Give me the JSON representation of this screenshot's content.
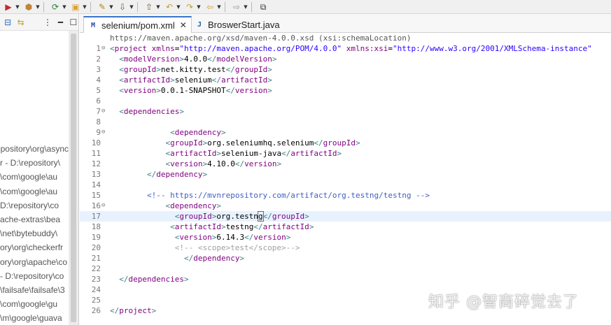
{
  "toolbar": {
    "items": [
      {
        "name": "run-icon",
        "glyph": "▶",
        "color": "#c62828"
      },
      {
        "name": "package-icon",
        "glyph": "⬢",
        "color": "#c0853a"
      },
      {
        "name": "refresh-icon",
        "glyph": "⟳",
        "color": "#2e7d32"
      },
      {
        "name": "open-folder-icon",
        "glyph": "▣",
        "color": "#d9a23a"
      },
      {
        "name": "wand-icon",
        "glyph": "✎",
        "color": "#b8860b"
      },
      {
        "name": "download-icon",
        "glyph": "⇩",
        "color": "#7a5b2e"
      },
      {
        "name": "upload-icon",
        "glyph": "⇧",
        "color": "#7a5b2e"
      },
      {
        "name": "back-history-icon",
        "glyph": "↶",
        "color": "#c7a033"
      },
      {
        "name": "forward-history-icon",
        "glyph": "↷",
        "color": "#c7a033"
      },
      {
        "name": "back-arrow-icon",
        "glyph": "⇦",
        "color": "#c7a033"
      },
      {
        "name": "forward-arrow-icon",
        "glyph": "⇨",
        "color": "#9a9a9a"
      },
      {
        "name": "new-window-icon",
        "glyph": "⧉",
        "color": "#333333"
      }
    ]
  },
  "left_panel": {
    "tools": [
      {
        "name": "collapse-icon",
        "glyph": "⊟",
        "color": "#2f6db5"
      },
      {
        "name": "link-editor-icon",
        "glyph": "⇆",
        "color": "#c7a033"
      },
      {
        "name": "view-menu-icon",
        "glyph": "⋮",
        "color": "#333333"
      },
      {
        "name": "minimize-icon",
        "glyph": "━",
        "color": "#333333"
      },
      {
        "name": "maximize-icon",
        "glyph": "☐",
        "color": "#333333"
      }
    ],
    "tree_items": [
      "epository\\org\\async",
      "r - D:\\repository\\",
      "\\com\\google\\au",
      "\\com\\google\\au",
      "D:\\repository\\co",
      "ache-extras\\bea",
      "\\net\\bytebuddy\\",
      "ory\\org\\checkerfr",
      "ory\\org\\apache\\co",
      "- D:\\repository\\co",
      "\\failsafe\\failsafe\\3",
      "\\com\\google\\gu",
      "\\m\\google\\guava"
    ]
  },
  "tabs": [
    {
      "label": "selenium/pom.xml",
      "icon_text": "M",
      "icon_color": "#2a4fa8",
      "active": true
    },
    {
      "label": "BroswerStart.java",
      "icon_text": "J",
      "icon_color": "#1f5fa8",
      "active": false
    }
  ],
  "editor": {
    "schema_hint": "https://maven.apache.org/xsd/maven-4.0.0.xsd (xsi:schemaLocation)",
    "lines": [
      {
        "n": "1",
        "fold": "⊖",
        "current": false,
        "segs": [
          [
            "tag",
            "<"
          ],
          [
            "name",
            "project"
          ],
          [
            "text",
            " "
          ],
          [
            "attr",
            "xmlns"
          ],
          [
            "text",
            "="
          ],
          [
            "val",
            "\"http://maven.apache.org/POM/4.0.0\""
          ],
          [
            "text",
            " "
          ],
          [
            "attr",
            "xmlns:xsi"
          ],
          [
            "text",
            "="
          ],
          [
            "val",
            "\"http://www.w3.org/2001/XMLSchema-instance\""
          ]
        ]
      },
      {
        "n": "2",
        "fold": "",
        "current": false,
        "segs": [
          [
            "text",
            "  "
          ],
          [
            "tag",
            "<"
          ],
          [
            "name",
            "modelVersion"
          ],
          [
            "tag",
            ">"
          ],
          [
            "text",
            "4.0.0"
          ],
          [
            "tag",
            "</"
          ],
          [
            "name",
            "modelVersion"
          ],
          [
            "tag",
            ">"
          ]
        ]
      },
      {
        "n": "3",
        "fold": "",
        "current": false,
        "segs": [
          [
            "text",
            "  "
          ],
          [
            "tag",
            "<"
          ],
          [
            "name",
            "groupId"
          ],
          [
            "tag",
            ">"
          ],
          [
            "text",
            "net.kitty.test"
          ],
          [
            "tag",
            "</"
          ],
          [
            "name",
            "groupId"
          ],
          [
            "tag",
            ">"
          ]
        ]
      },
      {
        "n": "4",
        "fold": "",
        "current": false,
        "segs": [
          [
            "text",
            "  "
          ],
          [
            "tag",
            "<"
          ],
          [
            "name",
            "artifactId"
          ],
          [
            "tag",
            ">"
          ],
          [
            "text",
            "selenium"
          ],
          [
            "tag",
            "</"
          ],
          [
            "name",
            "artifactId"
          ],
          [
            "tag",
            ">"
          ]
        ]
      },
      {
        "n": "5",
        "fold": "",
        "current": false,
        "segs": [
          [
            "text",
            "  "
          ],
          [
            "tag",
            "<"
          ],
          [
            "name",
            "version"
          ],
          [
            "tag",
            ">"
          ],
          [
            "text",
            "0.0.1-SNAPSHOT"
          ],
          [
            "tag",
            "</"
          ],
          [
            "name",
            "version"
          ],
          [
            "tag",
            ">"
          ]
        ]
      },
      {
        "n": "6",
        "fold": "",
        "current": false,
        "segs": []
      },
      {
        "n": "7",
        "fold": "⊖",
        "current": false,
        "segs": [
          [
            "text",
            "  "
          ],
          [
            "tag",
            "<"
          ],
          [
            "name",
            "dependencies"
          ],
          [
            "tag",
            ">"
          ]
        ]
      },
      {
        "n": "8",
        "fold": "",
        "current": false,
        "segs": []
      },
      {
        "n": "9",
        "fold": "⊖",
        "current": false,
        "segs": [
          [
            "text",
            "             "
          ],
          [
            "tag",
            "<"
          ],
          [
            "name",
            "dependency"
          ],
          [
            "tag",
            ">"
          ]
        ]
      },
      {
        "n": "10",
        "fold": "",
        "current": false,
        "segs": [
          [
            "text",
            "            "
          ],
          [
            "tag",
            "<"
          ],
          [
            "name",
            "groupId"
          ],
          [
            "tag",
            ">"
          ],
          [
            "text",
            "org.seleniumhq.selenium"
          ],
          [
            "tag",
            "</"
          ],
          [
            "name",
            "groupId"
          ],
          [
            "tag",
            ">"
          ]
        ]
      },
      {
        "n": "11",
        "fold": "",
        "current": false,
        "segs": [
          [
            "text",
            "            "
          ],
          [
            "tag",
            "<"
          ],
          [
            "name",
            "artifactId"
          ],
          [
            "tag",
            ">"
          ],
          [
            "text",
            "selenium-java"
          ],
          [
            "tag",
            "</"
          ],
          [
            "name",
            "artifactId"
          ],
          [
            "tag",
            ">"
          ]
        ]
      },
      {
        "n": "12",
        "fold": "",
        "current": false,
        "segs": [
          [
            "text",
            "            "
          ],
          [
            "tag",
            "<"
          ],
          [
            "name",
            "version"
          ],
          [
            "tag",
            ">"
          ],
          [
            "text",
            "4.10.0"
          ],
          [
            "tag",
            "</"
          ],
          [
            "name",
            "version"
          ],
          [
            "tag",
            ">"
          ]
        ]
      },
      {
        "n": "13",
        "fold": "",
        "current": false,
        "segs": [
          [
            "text",
            "        "
          ],
          [
            "tag",
            "</"
          ],
          [
            "name",
            "dependency"
          ],
          [
            "tag",
            ">"
          ]
        ]
      },
      {
        "n": "14",
        "fold": "",
        "current": false,
        "segs": []
      },
      {
        "n": "15",
        "fold": "",
        "current": false,
        "segs": [
          [
            "text",
            "        "
          ],
          [
            "com",
            "<!-- https://mvnrepository.com/artifact/org.testng/testng -->"
          ]
        ]
      },
      {
        "n": "16",
        "fold": "⊖",
        "current": false,
        "segs": [
          [
            "text",
            "            "
          ],
          [
            "tag",
            "<"
          ],
          [
            "name",
            "dependency"
          ],
          [
            "tag",
            ">"
          ]
        ]
      },
      {
        "n": "17",
        "fold": "",
        "current": true,
        "segs": [
          [
            "text",
            "              "
          ],
          [
            "tag",
            "<"
          ],
          [
            "name",
            "groupId"
          ],
          [
            "tag",
            ">"
          ],
          [
            "text",
            "org.testn"
          ],
          [
            "cursor",
            "g"
          ],
          [
            "tag",
            "</"
          ],
          [
            "name",
            "groupId"
          ],
          [
            "tag",
            ">"
          ]
        ]
      },
      {
        "n": "18",
        "fold": "",
        "current": false,
        "segs": [
          [
            "text",
            "             "
          ],
          [
            "tag",
            "<"
          ],
          [
            "name",
            "artifactId"
          ],
          [
            "tag",
            ">"
          ],
          [
            "text",
            "testng"
          ],
          [
            "tag",
            "</"
          ],
          [
            "name",
            "artifactId"
          ],
          [
            "tag",
            ">"
          ]
        ]
      },
      {
        "n": "19",
        "fold": "",
        "current": false,
        "segs": [
          [
            "text",
            "              "
          ],
          [
            "tag",
            "<"
          ],
          [
            "name",
            "version"
          ],
          [
            "tag",
            ">"
          ],
          [
            "text",
            "6.14.3"
          ],
          [
            "tag",
            "</"
          ],
          [
            "name",
            "version"
          ],
          [
            "tag",
            ">"
          ]
        ]
      },
      {
        "n": "20",
        "fold": "",
        "current": false,
        "segs": [
          [
            "text",
            "              "
          ],
          [
            "com2",
            "<!-- <scope>test</scope>-->"
          ]
        ]
      },
      {
        "n": "21",
        "fold": "",
        "current": false,
        "segs": [
          [
            "text",
            "                "
          ],
          [
            "tag",
            "</"
          ],
          [
            "name",
            "dependency"
          ],
          [
            "tag",
            ">"
          ]
        ]
      },
      {
        "n": "22",
        "fold": "",
        "current": false,
        "segs": []
      },
      {
        "n": "23",
        "fold": "",
        "current": false,
        "segs": [
          [
            "text",
            "  "
          ],
          [
            "tag",
            "</"
          ],
          [
            "name",
            "dependencies"
          ],
          [
            "tag",
            ">"
          ]
        ]
      },
      {
        "n": "24",
        "fold": "",
        "current": false,
        "segs": []
      },
      {
        "n": "25",
        "fold": "",
        "current": false,
        "segs": []
      },
      {
        "n": "26",
        "fold": "",
        "current": false,
        "segs": [
          [
            "tag",
            "</"
          ],
          [
            "name",
            "project"
          ],
          [
            "tag",
            ">"
          ]
        ]
      }
    ]
  },
  "watermark": "知乎 @智商碎觉去了"
}
